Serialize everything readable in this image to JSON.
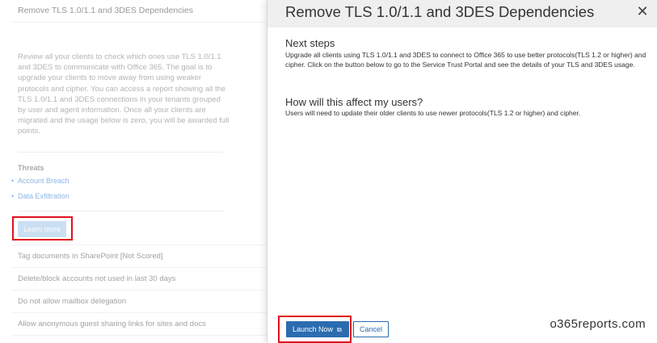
{
  "background": {
    "header_title": "Remove TLS 1.0/1.1 and 3DES Dependencies",
    "description": "Review all your clients to check which ones use TLS 1.0/1.1 and 3DES to communicate with Office 365. The goal is to upgrade your clients to move away from using weaker protocols and cipher. You can access a report showing all the TLS 1.0/1.1 and 3DES connections in your tenants grouped by user and agent information. Once all your clients are migrated and the usage below is zero, you will be awarded full points.",
    "threats_title": "Threats",
    "threats": [
      "Account Breach",
      "Data Exfiltration"
    ],
    "learn_more_label": "Learn more",
    "rows": [
      "Tag documents in SharePoint [Not Scored]",
      "Delete/block accounts not used in last 30 days",
      "Do not allow mailbox delegation",
      "Allow anonymous guest sharing links for sites and docs"
    ]
  },
  "panel": {
    "title": "Remove TLS 1.0/1.1 and 3DES Dependencies",
    "close_glyph": "✕",
    "next_steps_title": "Next steps",
    "next_steps_text": "Upgrade all clients using TLS 1.0/1.1 and 3DES to connect to Office 365 to use better protocols(TLS 1.2 or higher) and cipher. Click on the button below to go to the Service Trust Portal and see the details of your TLS and 3DES usage.",
    "affect_title": "How will this affect my users?",
    "affect_text": "Users will need to update their older clients to use newer protocols(TLS 1.2 or higher) and cipher.",
    "launch_label": "Launch Now",
    "cancel_label": "Cancel"
  },
  "watermark": "o365reports.com",
  "colors": {
    "primary": "#2b6cb0",
    "highlight": "#e0101d",
    "link": "#2b7cd3"
  }
}
